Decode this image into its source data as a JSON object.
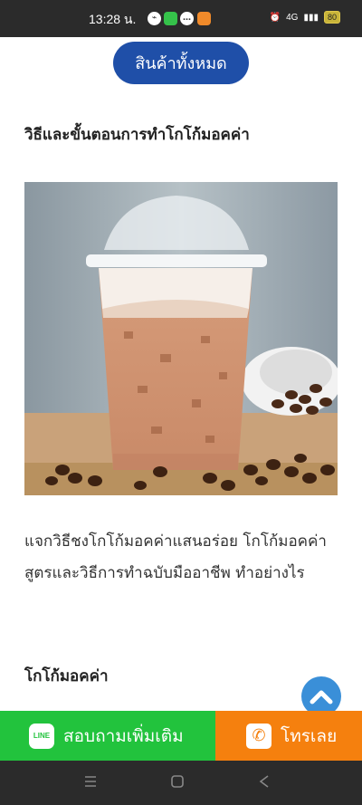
{
  "status": {
    "time": "13:28 น.",
    "network": "4G",
    "battery": "80",
    "colors": {
      "bar": "#2b2b2b",
      "battery": "#c9b53a"
    }
  },
  "header": {
    "all_products_label": "สินค้าทั้งหมด"
  },
  "article": {
    "section_title": "วิธีและขั้นตอนการทำโกโก้มอคค่า",
    "paragraph": "แจกวิธีชงโกโก้มอคค่าแสนอร่อย โกโก้มอคค่า สูตรและวิธีการทำฉบับมืออาชีพ ทำอย่างไร",
    "subheading": "โกโก้มอคค่า"
  },
  "cta": {
    "line_label": "สอบถามเพิ่มเติม",
    "line_icon_text": "LINE",
    "call_label": "โทรเลย",
    "colors": {
      "line": "#22c33d",
      "call": "#f5800e",
      "primary": "#1f4fa8",
      "scroll_top": "#3a8fd8"
    }
  },
  "icons": [
    "messenger-icon",
    "line-icon",
    "chat-icon",
    "app-icon",
    "alarm-icon",
    "signal-icon",
    "battery-icon",
    "chevron-up-icon",
    "phone-icon",
    "nav-menu-icon",
    "nav-home-icon",
    "nav-back-icon"
  ]
}
